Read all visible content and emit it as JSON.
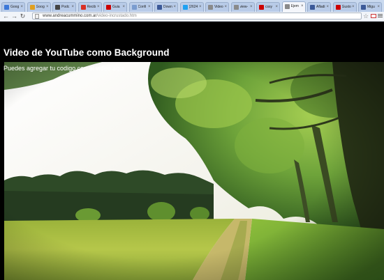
{
  "browser": {
    "tabs": [
      {
        "label": "Goog",
        "color": "#3c78d8"
      },
      {
        "label": "Goog",
        "color": "#e0a020"
      },
      {
        "label": "Podc",
        "color": "#444444"
      },
      {
        "label": "Recib",
        "color": "#d93025"
      },
      {
        "label": "Guia",
        "color": "#cc0000"
      },
      {
        "label": "Confi",
        "color": "#7a9ccf"
      },
      {
        "label": "Down",
        "color": "#3b5998"
      },
      {
        "label": "(2624",
        "color": "#1da1f2"
      },
      {
        "label": "Video",
        "color": "#8a8a8a"
      },
      {
        "label": "view-",
        "color": "#8a8a8a"
      },
      {
        "label": "cssy",
        "color": "#cc0000"
      },
      {
        "label": "Ejem",
        "color": "#8a8a8a",
        "active": true
      },
      {
        "label": "Afladi",
        "color": "#3b5998"
      },
      {
        "label": "Gusto",
        "color": "#cc0000"
      },
      {
        "label": "Migu",
        "color": "#3b5998"
      }
    ],
    "address": {
      "domain": "www.andreacummino.com.ar",
      "path": "/video-incrustado.htm"
    }
  },
  "page": {
    "title": "Video de YouTube como Background",
    "subtitle": "Puedes agregar tu codigo con el video aqui"
  }
}
